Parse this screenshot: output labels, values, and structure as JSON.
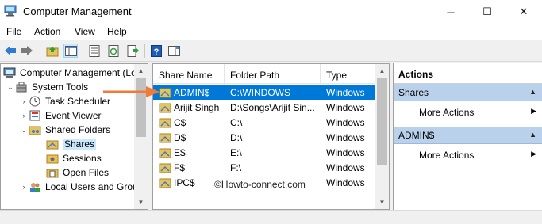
{
  "window": {
    "title": "Computer Management",
    "minimize": "─",
    "maximize": "☐",
    "close": "✕"
  },
  "menu": [
    "File",
    "Action",
    "View",
    "Help"
  ],
  "tree": {
    "items": [
      {
        "label": "Computer Management (Lc",
        "expander": "",
        "icon": "computer-icon",
        "selected": false
      },
      {
        "label": "System Tools",
        "expander": "⌄",
        "icon": "tools-icon",
        "selected": false
      },
      {
        "label": "Task Scheduler",
        "expander": "›",
        "icon": "clock-icon",
        "selected": false
      },
      {
        "label": "Event Viewer",
        "expander": "›",
        "icon": "event-viewer-icon",
        "selected": false
      },
      {
        "label": "Shared Folders",
        "expander": "⌄",
        "icon": "shared-folder-icon",
        "selected": false
      },
      {
        "label": "Shares",
        "expander": "",
        "icon": "shares-icon",
        "selected": true
      },
      {
        "label": "Sessions",
        "expander": "",
        "icon": "sessions-icon",
        "selected": false
      },
      {
        "label": "Open Files",
        "expander": "",
        "icon": "open-files-icon",
        "selected": false
      },
      {
        "label": "Local Users and Grou",
        "expander": "›",
        "icon": "users-icon",
        "selected": false
      }
    ]
  },
  "list": {
    "columns": [
      "Share Name",
      "Folder Path",
      "Type"
    ],
    "rows": [
      {
        "name": "ADMIN$",
        "path": "C:\\WINDOWS",
        "type": "Windows",
        "selected": true
      },
      {
        "name": "Arijit Singh",
        "path": "D:\\Songs\\Arijit Sin...",
        "type": "Windows",
        "selected": false
      },
      {
        "name": "C$",
        "path": "C:\\",
        "type": "Windows",
        "selected": false
      },
      {
        "name": "D$",
        "path": "D:\\",
        "type": "Windows",
        "selected": false
      },
      {
        "name": "E$",
        "path": "E:\\",
        "type": "Windows",
        "selected": false
      },
      {
        "name": "F$",
        "path": "F:\\",
        "type": "Windows",
        "selected": false
      },
      {
        "name": "IPC$",
        "path": "",
        "type": "Windows",
        "selected": false
      }
    ]
  },
  "watermark": "©Howto-connect.com",
  "actions": {
    "title": "Actions",
    "sections": [
      {
        "header": "Shares",
        "item": "More Actions"
      },
      {
        "header": "ADMIN$",
        "item": "More Actions"
      }
    ]
  },
  "colors": {
    "selection": "#0078d7",
    "section_header": "#b9d1ea",
    "arrow": "#f07a38"
  }
}
